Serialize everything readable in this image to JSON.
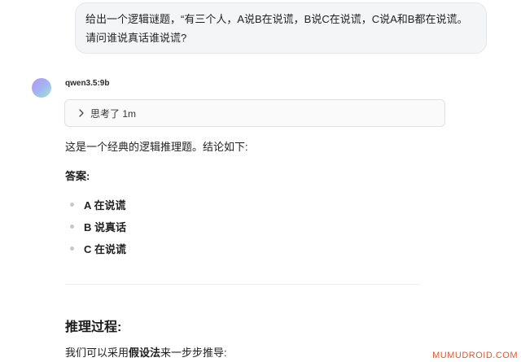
{
  "user_message": {
    "text": "给出一个逻辑谜题，“有三个人，A说B在说谎，B说C在说谎，C说A和B都在说谎。请问谁说真话谁说谎?"
  },
  "assistant": {
    "model_name": "qwen3.5:9b",
    "thinking_label": "思考了 1m",
    "intro": "这是一个经典的逻辑推理题。结论如下:",
    "answer_heading": "答案:",
    "answers": [
      "A 在说谎",
      "B 说真话",
      "C 在说谎"
    ],
    "reasoning_heading": "推理过程:",
    "reasoning_intro_before": "我们可以采用",
    "reasoning_intro_bold": "假设法",
    "reasoning_intro_after": "来一步步推导:"
  },
  "watermark": "MUMUDROID.COM",
  "colors": {
    "watermark": "#e4572e",
    "bubble_bg": "#f4f5f7"
  },
  "icons": {
    "thinking_toggle": "chevron-right-icon"
  }
}
